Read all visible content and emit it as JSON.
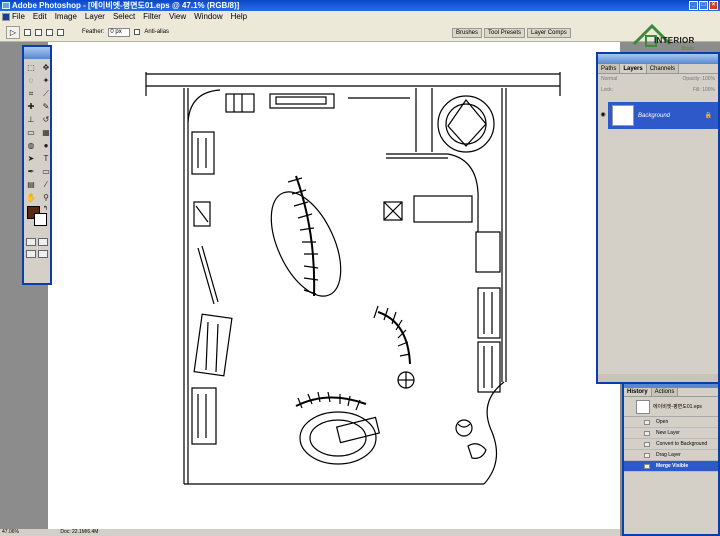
{
  "window": {
    "title": "Adobe Photoshop - [에이비엣-평면도01.eps @ 47.1% (RGB/8)]"
  },
  "menu": [
    "File",
    "Edit",
    "Image",
    "Layer",
    "Select",
    "Filter",
    "View",
    "Window",
    "Help"
  ],
  "options": {
    "feather_label": "Feather:",
    "feather_value": "0 px",
    "antialias_label": "Anti-alias"
  },
  "palette_well": [
    "Brushes",
    "Tool Presets",
    "Layer Comps"
  ],
  "status": {
    "zoom": "47.06%",
    "doc": "Doc: 22.1M/6.4M"
  },
  "layers_panel": {
    "tabs": [
      "Paths",
      "Layers",
      "Channels"
    ],
    "blend_mode": "Normal",
    "opacity_label": "Opacity:",
    "opacity_value": "100%",
    "lock_label": "Lock:",
    "fill_label": "Fill:",
    "fill_value": "100%",
    "layer_name": "Background"
  },
  "history_panel": {
    "tabs": [
      "History",
      "Actions"
    ],
    "snapshot": "에이비엣-평면도01.eps",
    "items": [
      "Open",
      "New Layer",
      "Convert to Background",
      "Drag Layer",
      "Merge Visible"
    ]
  },
  "logo": {
    "text": "INTERIOR",
    "sub": "Brain"
  },
  "colors": {
    "title_blue": "#0a48c8",
    "selection_blue": "#2d5ac8",
    "foreground": "#5a2a10",
    "logo_green": "#4a8a3a"
  },
  "icons": [
    "selection-tool-icon",
    "eye-icon",
    "lock-icon"
  ]
}
